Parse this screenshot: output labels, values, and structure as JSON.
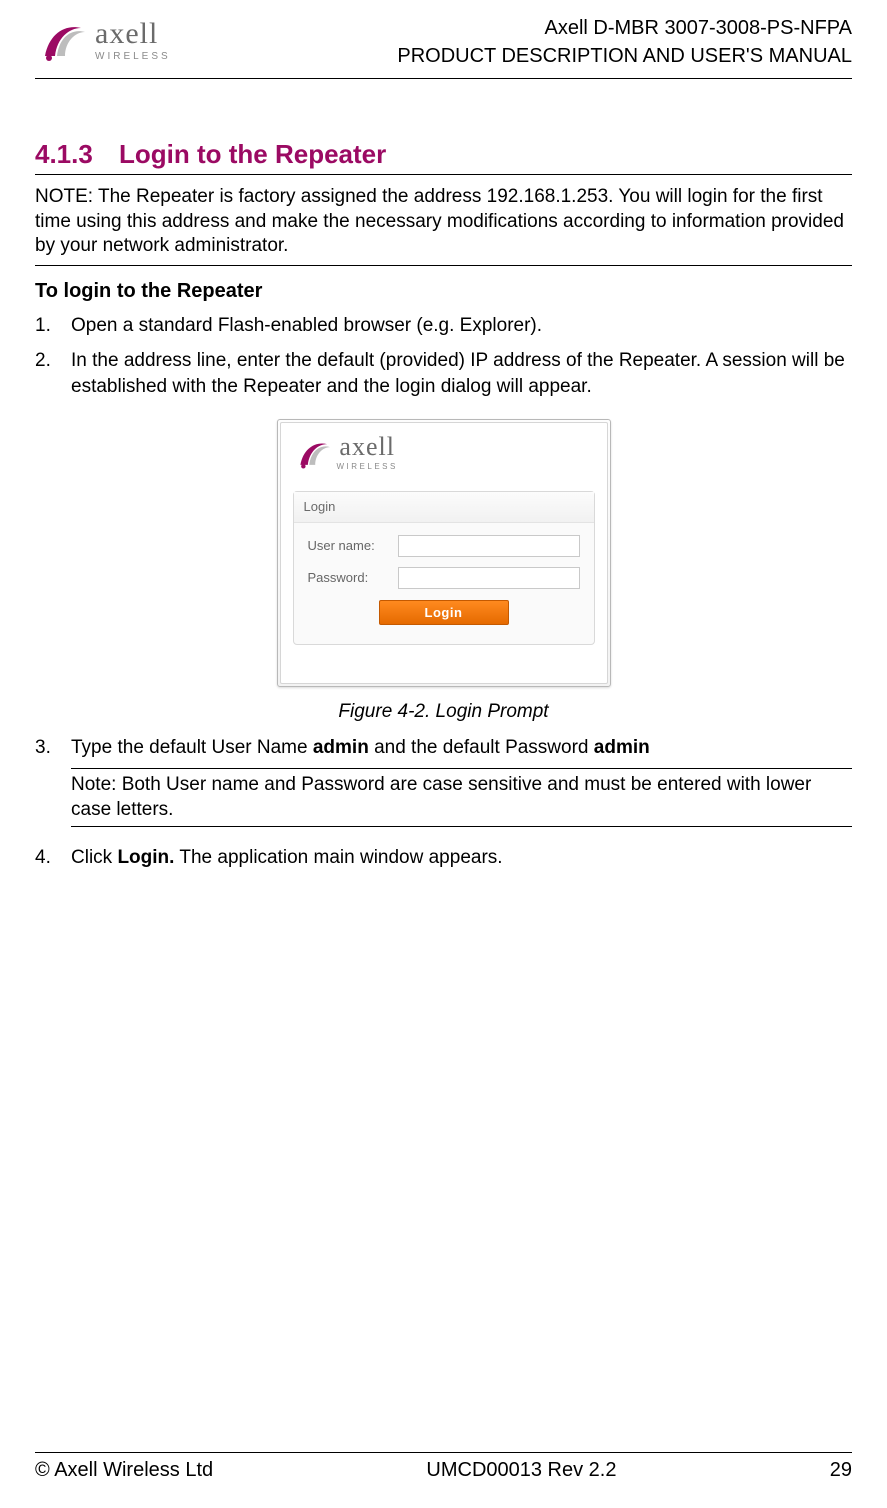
{
  "header": {
    "brand_name": "axell",
    "brand_sub": "WIRELESS",
    "product_line1": "Axell D-MBR 3007-3008-PS-NFPA",
    "product_line2": "PRODUCT DESCRIPTION AND USER'S MANUAL"
  },
  "section": {
    "number": "4.1.3",
    "title": "Login to the Repeater"
  },
  "note_main": "NOTE: The Repeater is factory assigned the address 192.168.1.253. You will login for the first time using this address and make the necessary modifications according to information provided by your network administrator.",
  "subhead": "To login to the Repeater",
  "steps": {
    "s1": {
      "n": "1.",
      "t": "Open a standard Flash-enabled browser (e.g. Explorer)."
    },
    "s2": {
      "n": "2.",
      "t": "In the address line, enter the default (provided) IP address of the Repeater. A session will be established with the Repeater and the login dialog will appear."
    },
    "s3": {
      "n": "3.",
      "pre": "Type the default User Name ",
      "b1": "admin",
      "mid": " and the default Password ",
      "b2": "admin"
    },
    "s3_note": "Note: Both User name and Password are case sensitive and must be entered with lower case letters.",
    "s4": {
      "n": "4.",
      "pre": "Click ",
      "b1": "Login.",
      "post": " The application main window appears."
    }
  },
  "figure": {
    "caption": "Figure 4-2. Login Prompt",
    "panel_title": "Login",
    "username_label": "User name:",
    "password_label": "Password:",
    "login_button": "Login",
    "username_value": "",
    "password_value": ""
  },
  "footer": {
    "left": "© Axell Wireless Ltd",
    "center": "UMCD00013 Rev 2.2",
    "right": "29"
  },
  "colors": {
    "heading": "#9b0a63",
    "button_bg": "#ef7a12"
  }
}
